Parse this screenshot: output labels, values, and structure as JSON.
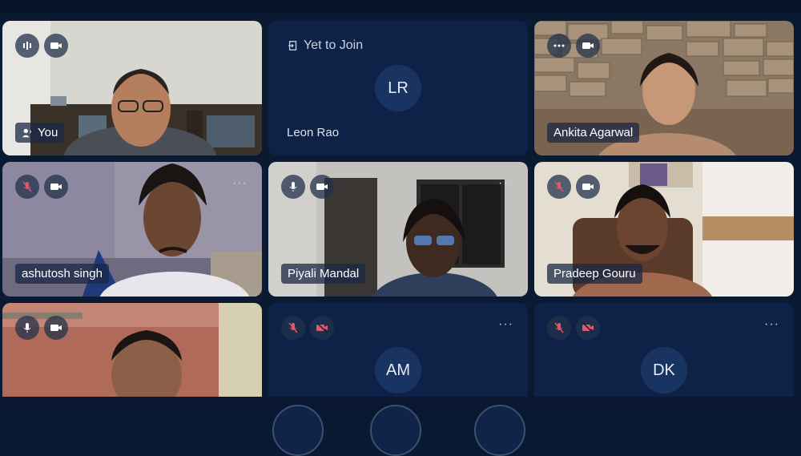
{
  "tiles": {
    "you": {
      "name": "You"
    },
    "leon": {
      "status": "Yet to Join",
      "initials": "LR",
      "name": "Leon Rao"
    },
    "ankita": {
      "name": "Ankita Agarwal"
    },
    "ashutosh": {
      "name": "ashutosh singh"
    },
    "piyali": {
      "name": "Piyali Mandal"
    },
    "pradeep": {
      "name": "Pradeep Gouru"
    },
    "am": {
      "initials": "AM"
    },
    "dk": {
      "initials": "DK"
    }
  },
  "more_label": "···",
  "colors": {
    "background": "#0b1a33",
    "tile": "#0e2247",
    "muted_red": "#e0566a",
    "avatar_bg": "#1a3462"
  }
}
